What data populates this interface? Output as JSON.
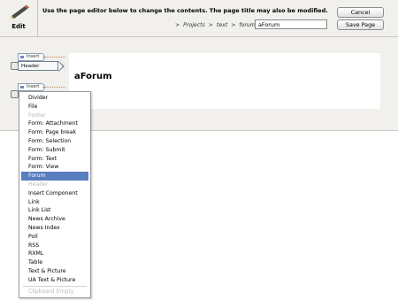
{
  "toolbar": {
    "edit_label": "Edit",
    "instruction": "Use the page editor below to change the contents. The page title may also be modified.",
    "breadcrumb": [
      "Projects",
      "text",
      "forum"
    ],
    "breadcrumb_separator": ">",
    "title_value": "aForum",
    "cancel_label": "Cancel",
    "save_label": "Save Page"
  },
  "page": {
    "heading": "aForum",
    "insert_label": "Insert",
    "header_chip": "Header"
  },
  "insert_menu": {
    "items": [
      {
        "label": "Divider",
        "state": "enabled"
      },
      {
        "label": "File",
        "state": "enabled"
      },
      {
        "label": "Footer",
        "state": "disabled"
      },
      {
        "label": "Form: Attachment",
        "state": "enabled"
      },
      {
        "label": "Form: Page break",
        "state": "enabled"
      },
      {
        "label": "Form: Selection",
        "state": "enabled"
      },
      {
        "label": "Form: Submit",
        "state": "enabled"
      },
      {
        "label": "Form: Text",
        "state": "enabled"
      },
      {
        "label": "Form: View",
        "state": "enabled"
      },
      {
        "label": "Forum",
        "state": "selected"
      },
      {
        "label": "Header",
        "state": "disabled"
      },
      {
        "label": "Insert Component",
        "state": "enabled"
      },
      {
        "label": "Link",
        "state": "enabled"
      },
      {
        "label": "Link List",
        "state": "enabled"
      },
      {
        "label": "News Archive",
        "state": "enabled"
      },
      {
        "label": "News Index",
        "state": "enabled"
      },
      {
        "label": "Poll",
        "state": "enabled"
      },
      {
        "label": "RSS",
        "state": "enabled"
      },
      {
        "label": "RXML",
        "state": "enabled"
      },
      {
        "label": "Table",
        "state": "enabled"
      },
      {
        "label": "Text & Picture",
        "state": "enabled"
      },
      {
        "label": "UA Text & Picture",
        "state": "enabled"
      }
    ],
    "footer_item": {
      "label": "Clipboard Empty",
      "state": "disabled"
    }
  },
  "colors": {
    "toolbar_bg": "#f1f0ec",
    "selected_bg": "#5a7dbf",
    "disabled_text": "#b8b8b8"
  }
}
